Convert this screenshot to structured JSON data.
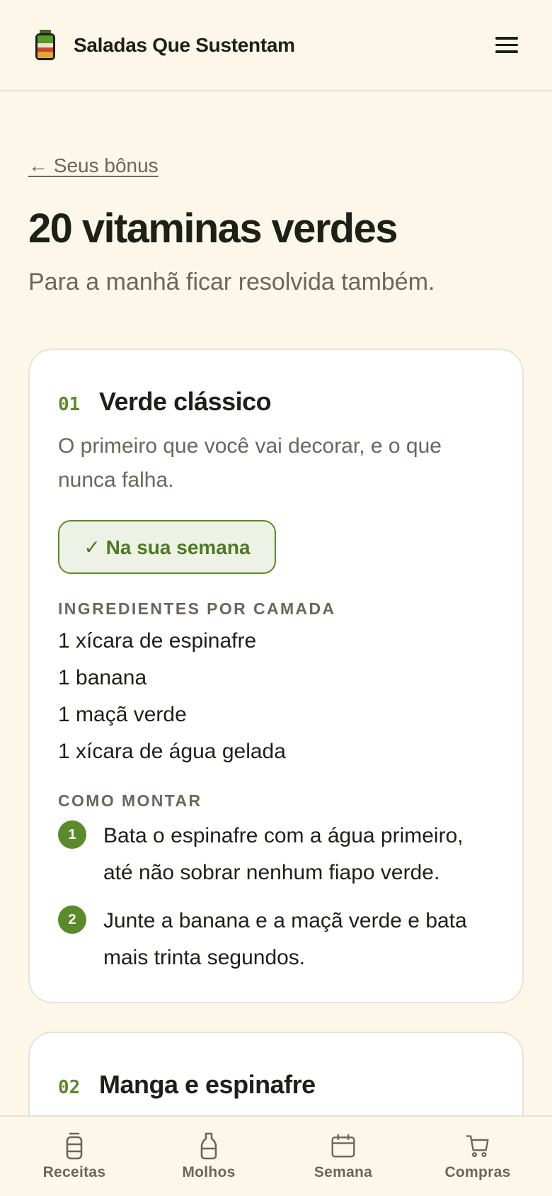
{
  "header": {
    "logo_icon": "salad-jar-icon",
    "title": "Saladas Que Sustentam",
    "menu_icon": "hamburger-menu-icon"
  },
  "back_link": "← Seus bônus",
  "page": {
    "title": "20 vitaminas verdes",
    "subtitle": "Para a manhã ficar resolvida também."
  },
  "recipes": [
    {
      "number": "01",
      "title": "Verde clássico",
      "description": "O primeiro que você vai decorar, e o que nunca falha.",
      "week_button": "✓ Na sua semana",
      "ingredients_label": "INGREDIENTES POR CAMADA",
      "ingredients": [
        "1 xícara de espinafre",
        "1 banana",
        "1 maçã verde",
        "1 xícara de água gelada"
      ],
      "steps_label": "COMO MONTAR",
      "steps": [
        {
          "num": "1",
          "text": "Bata o espinafre com a água primeiro, até não sobrar nenhum fiapo verde."
        },
        {
          "num": "2",
          "text": "Junte a banana e a maçã verde e bata mais trinta segundos."
        }
      ]
    },
    {
      "number": "02",
      "title": "Manga e espinafre"
    }
  ],
  "bottom_nav": [
    {
      "label": "Receitas",
      "icon": "jar-icon"
    },
    {
      "label": "Molhos",
      "icon": "bottle-icon"
    },
    {
      "label": "Semana",
      "icon": "calendar-icon"
    },
    {
      "label": "Compras",
      "icon": "cart-icon"
    }
  ],
  "colors": {
    "background": "#fdf7ea",
    "accent_green": "#5a8a2a",
    "muted_text": "#6b6658",
    "card_border": "#e6e2d6"
  }
}
